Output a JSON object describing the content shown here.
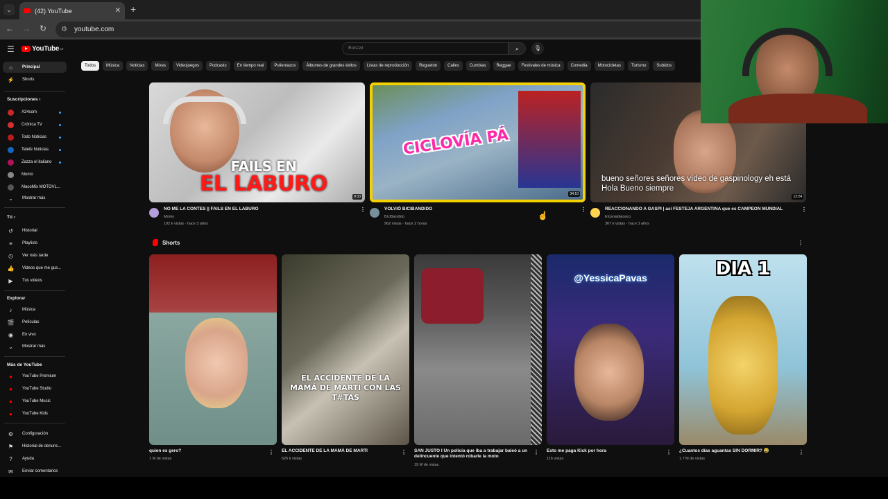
{
  "browser": {
    "tab_title": "(42) YouTube",
    "url": "youtube.com"
  },
  "header": {
    "logo_text": "YouTube",
    "logo_region": "AR",
    "search_placeholder": "Buscar"
  },
  "chips": [
    "Todos",
    "Música",
    "Noticias",
    "Mixes",
    "Videojuegos",
    "Podcasts",
    "En tiempo real",
    "Pulientazos",
    "Álbumes de grandes éxitos",
    "Listas de reproducción",
    "Reguetón",
    "Calles",
    "Cumbias",
    "Reggae",
    "Festivales de música",
    "Comedia",
    "Motocicletas",
    "Turismo",
    "Subidos"
  ],
  "sidebar": {
    "home": "Principal",
    "shorts": "Shorts",
    "subs_header": "Suscripciones",
    "subscriptions": [
      {
        "name": "A24com",
        "color": "#c62828",
        "live": true
      },
      {
        "name": "Crónica TV",
        "color": "#d32f2f",
        "live": true
      },
      {
        "name": "Todo Noticias",
        "color": "#b71c1c",
        "live": true
      },
      {
        "name": "Telefe Noticias",
        "color": "#1565c0",
        "live": true
      },
      {
        "name": "Zazza el italiano",
        "color": "#ad1457",
        "live": true
      },
      {
        "name": "Momo",
        "color": "#888888",
        "live": false
      },
      {
        "name": "MacoMix MOTOVL...",
        "color": "#555555",
        "live": false
      }
    ],
    "show_more_1": "Mostrar más",
    "you_header": "Tú",
    "you_items": [
      "Historial",
      "Playlists",
      "Ver más tarde",
      "Videos que me gus...",
      "Tus videos"
    ],
    "explore_header": "Explorar",
    "explore_items": [
      "Música",
      "Películas",
      "En vivo"
    ],
    "show_more_2": "Mostrar más",
    "more_header": "Más de YouTube",
    "more_items": [
      "YouTube Premium",
      "YouTube Studio",
      "YouTube Music",
      "YouTube Kids"
    ],
    "settings_items": [
      "Configuración",
      "Historial de denunc...",
      "Ayuda",
      "Enviar comentarios"
    ]
  },
  "videos": [
    {
      "title": "NO ME LA CONTES || FAILS EN EL LABURO",
      "channel": "Momo",
      "stats": "192 k vistas · hace 3 años",
      "duration": "8:33",
      "overlay": "FAILS EN EL LABURO"
    },
    {
      "title": "VOLVIÓ BICIBANDIDO",
      "channel": "BiciBandido",
      "stats": "962 vistas · hace 2 horas",
      "duration": "34:10",
      "overlay": "CICLOVÍA PÁ"
    },
    {
      "title": "REACCIONANDO A GASPI | así FESTEJA ARGENTINA que es CAMPEON MUNDIAL",
      "channel": "Elcanaldejoaco",
      "stats": "367 k vistas · hace 3 años",
      "duration": "12:24",
      "overlay": "bueno señores señores vídeo de gaspinology eh está Hola Bueno siempre"
    }
  ],
  "shorts_header": "Shorts",
  "shorts": [
    {
      "title": "quien es gero?",
      "views": "1 M de vistas",
      "overlay": ""
    },
    {
      "title": "EL ACCIDENTE DE LA MAMÁ DE MARTI",
      "views": "626 k vistas",
      "overlay": "EL ACCIDENTE DE LA MAMÁ DE MARTI CON LAS T#TAS"
    },
    {
      "title": "SAN JUSTO I Un policía que iba a trabajar baleó a un delincuente que intentó robarle la moto",
      "views": "19 M de vistas",
      "overlay": ""
    },
    {
      "title": "Esto me paga Kick por hora",
      "views": "116 vistas",
      "overlay": "@YessicaPavas"
    },
    {
      "title": "¿Cuantos días aguantas SIN DORMIR? 😂",
      "views": "1.7 M de vistas",
      "overlay": "DIA 1"
    }
  ],
  "colors": {
    "accent": "#ff0000",
    "bg": "#0f0f0f",
    "chip": "#272727",
    "live": "#3ea6ff"
  }
}
